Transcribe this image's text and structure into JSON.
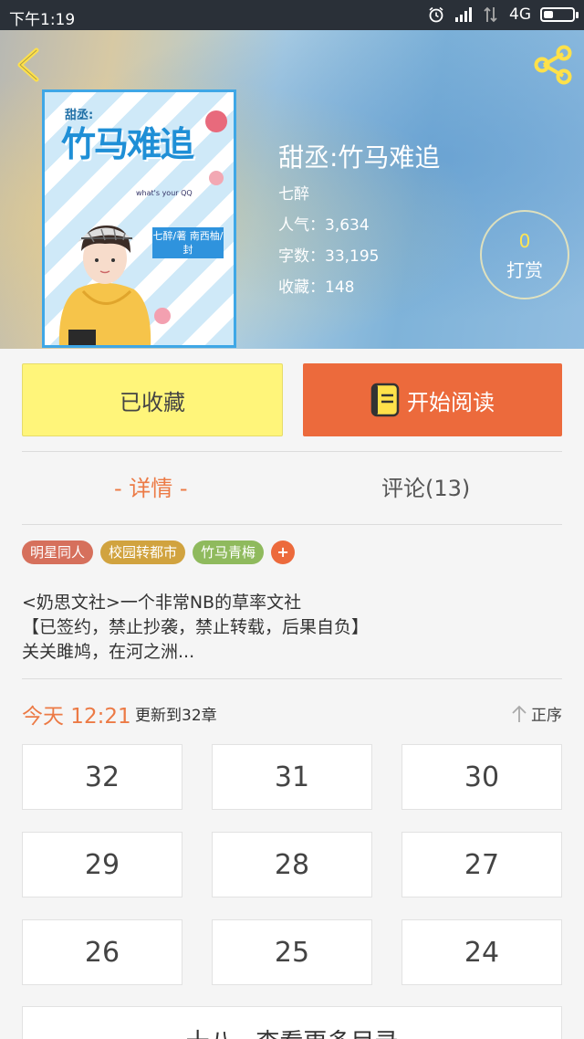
{
  "status_bar": {
    "time": "下午1:19",
    "network": "4G"
  },
  "book": {
    "title": "甜丞:竹马难追",
    "author": "七醉",
    "popularity": "人气：3,634",
    "word_count": "字数：33,195",
    "favorites": "收藏：148"
  },
  "cover": {
    "title": "竹马难追",
    "subtitle": "甜丞:",
    "small_text": "what's your QQ",
    "author_box": "七醉/著 南西柚/封"
  },
  "reward": {
    "count": "0",
    "label": "打赏"
  },
  "actions": {
    "collected_label": "已收藏",
    "read_label": "开始阅读"
  },
  "tabs": [
    {
      "label": "- 详情 -",
      "active": true
    },
    {
      "label": "评论(13)",
      "active": false
    }
  ],
  "tags": [
    {
      "label": "明星同人",
      "color": "#d6705c"
    },
    {
      "label": "校园转都市",
      "color": "#d1a33f"
    },
    {
      "label": "竹马青梅",
      "color": "#8fba5d"
    }
  ],
  "tag_add_label": "+",
  "description": {
    "line1": "<奶思文社>一个非常NB的草率文社",
    "line2": "【已签约，禁止抄袭，禁止转载，后果自负】",
    "line3": "关关雎鸠，在河之洲..."
  },
  "update": {
    "time": "今天 12:21",
    "text": "更新到32章",
    "sort_label": "正序"
  },
  "chapters": [
    "32",
    "31",
    "30",
    "29",
    "28",
    "27",
    "26",
    "25",
    "24"
  ],
  "more_button": "十八 · 查看更多目录",
  "colors": {
    "accent": "#ec6a3c",
    "collected_bg": "#fff57a",
    "active_tab": "#ec7a45"
  }
}
